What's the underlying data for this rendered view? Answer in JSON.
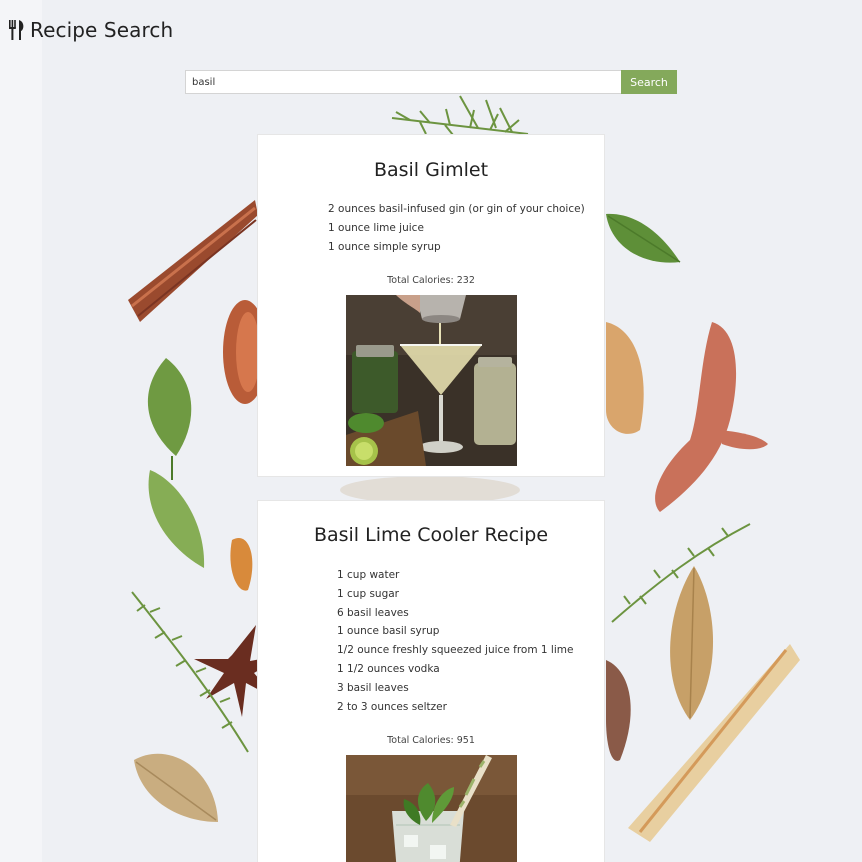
{
  "header": {
    "title": "Recipe Search",
    "logo_icon": "fork-knife-icon"
  },
  "search": {
    "value": "basil",
    "placeholder": "",
    "button_label": "Search"
  },
  "colors": {
    "accent": "#84a95b",
    "background": "#eef0f4"
  },
  "results": [
    {
      "title": "Basil Gimlet",
      "ingredients": [
        "2 ounces basil-infused gin (or gin of your choice)",
        "1 ounce lime juice",
        "1 ounce simple syrup"
      ],
      "calories": "Total Calories: 232",
      "image": "basil-gimlet-photo"
    },
    {
      "title": "Basil Lime Cooler Recipe",
      "ingredients": [
        "1 cup water",
        "1 cup sugar",
        "6 basil leaves",
        "1 ounce basil syrup",
        "1/2 ounce freshly squeezed juice from 1 lime",
        "1 1/2 ounces vodka",
        "3 basil leaves",
        "2 to 3 ounces seltzer"
      ],
      "calories": "Total Calories: 951",
      "image": "basil-lime-cooler-photo"
    }
  ]
}
